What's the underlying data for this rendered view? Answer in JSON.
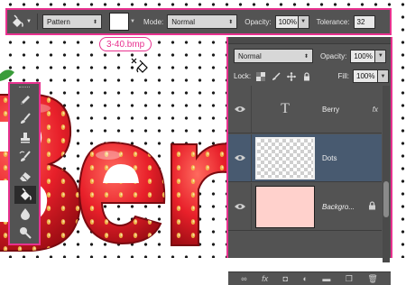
{
  "options_bar": {
    "fill_source": "Pattern",
    "mode_label": "Mode:",
    "mode_value": "Normal",
    "opacity_label": "Opacity:",
    "opacity_value": "100%",
    "tolerance_label": "Tolerance:",
    "tolerance_value": "32"
  },
  "pattern_tip": "3-40.bmp",
  "tools": [
    {
      "icon": "pencil-icon"
    },
    {
      "icon": "brush-icon"
    },
    {
      "icon": "stamp-icon"
    },
    {
      "icon": "history-brush-icon"
    },
    {
      "icon": "eraser-icon"
    },
    {
      "icon": "paint-bucket-icon",
      "active": true
    },
    {
      "icon": "blur-icon"
    },
    {
      "icon": "dodge-icon"
    }
  ],
  "layers_panel": {
    "blend_mode": "Normal",
    "opacity_label": "Opacity:",
    "opacity_value": "100%",
    "lock_label": "Lock:",
    "fill_label": "Fill:",
    "fill_value": "100%",
    "layers": [
      {
        "name": "Berry",
        "type": "text",
        "fx": "fx"
      },
      {
        "name": "Dots",
        "type": "transparent",
        "selected": true
      },
      {
        "name": "Backgro...",
        "type": "background",
        "locked": true
      }
    ]
  },
  "colors": {
    "accent": "#e8318f",
    "panel": "#535353",
    "selected_layer": "#485a70",
    "strawberry": "#e8202a"
  }
}
